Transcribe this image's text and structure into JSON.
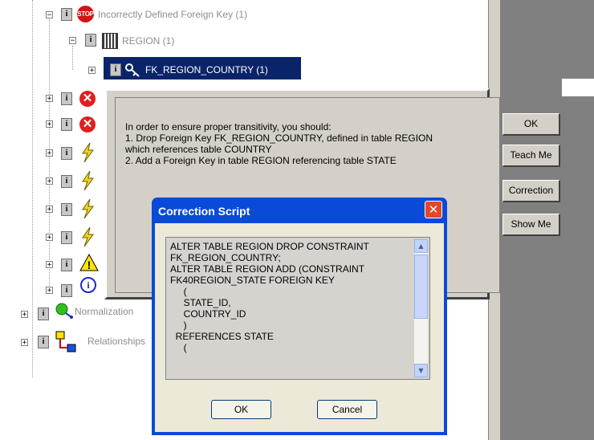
{
  "tree": {
    "incorrect_fk_label": "Incorrectly Defined Foreign Key (1)",
    "stop_badge": "STOP",
    "region_label": "REGION (1)",
    "fk_label": "FK_REGION_COUNTRY (1)",
    "normalization_label": "Normalization",
    "relationships_label": "Relationships",
    "expander_plus": "+",
    "expander_minus": "−",
    "info_glyph": "i",
    "error_glyph": "✕",
    "warning_glyph": "!",
    "note_glyph": "i"
  },
  "advice_dialog": {
    "message": "In order to ensure proper transitivity, you should:\n1. Drop Foreign Key FK_REGION_COUNTRY, defined in table REGION\nwhich references table COUNTRY\n2. Add a Foreign Key in table REGION referencing table STATE",
    "buttons": {
      "ok": "OK",
      "teach_me": "Teach Me",
      "correction": "Correction",
      "show_me": "Show Me"
    }
  },
  "correction_script": {
    "title": "Correction Script",
    "close_glyph": "✕",
    "script": "ALTER TABLE REGION DROP CONSTRAINT\nFK_REGION_COUNTRY;\nALTER TABLE REGION ADD (CONSTRAINT\nFK40REGION_STATE FOREIGN KEY\n     (\n     STATE_ID,\n     COUNTRY_ID\n     )\n  REFERENCES STATE\n     (",
    "scroll_up_glyph": "▲",
    "scroll_down_glyph": "▼",
    "ok_label": "OK",
    "cancel_label": "Cancel"
  },
  "icons": {
    "info": "info-icon",
    "stop": "stop-icon",
    "table": "table-icon",
    "key": "key-icon",
    "error": "error-icon",
    "lightning": "lightning-icon",
    "warning": "warning-icon",
    "note": "note-icon",
    "normalization": "normalization-icon",
    "relationships": "relationships-icon"
  },
  "colors": {
    "selection": "#0a246a",
    "window_face": "#d4d0c8",
    "xp_title": "#0a4ad8",
    "xp_close": "#e0482a"
  }
}
